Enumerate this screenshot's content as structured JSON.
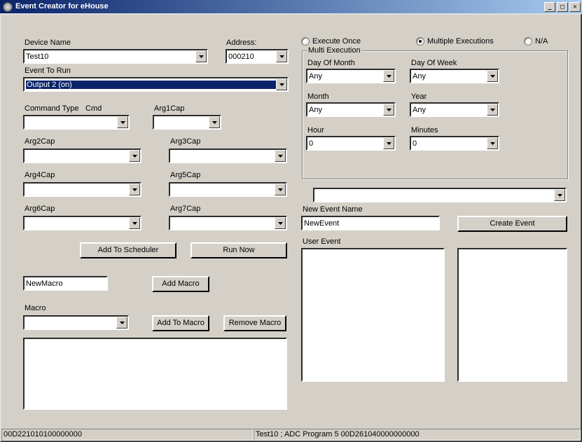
{
  "window": {
    "title": "Event Creator for eHouse"
  },
  "left": {
    "device_name_label": "Device Name",
    "device_name": "Test10",
    "address_label": "Address:",
    "address": "000210",
    "event_to_run_label": "Event To Run",
    "event_to_run": "Output 2 (on)",
    "command_type_label": "Command Type",
    "cmd_label": "Cmd",
    "command_type": "",
    "cmd": "",
    "arg1_label": "Arg1Cap",
    "arg1": "",
    "arg2_label": "Arg2Cap",
    "arg2": "",
    "arg3_label": "Arg3Cap",
    "arg3": "",
    "arg4_label": "Arg4Cap",
    "arg4": "",
    "arg5_label": "Arg5Cap",
    "arg5": "",
    "arg6_label": "Arg6Cap",
    "arg6": "",
    "arg7_label": "Arg7Cap",
    "arg7": "",
    "add_to_scheduler_btn": "Add To Scheduler",
    "run_now_btn": "Run Now",
    "newmacro_value": "NewMacro",
    "add_macro_btn": "Add Macro",
    "macro_label": "Macro",
    "macro": "",
    "add_to_macro_btn": "Add To Macro",
    "remove_macro_btn": "Remove Macro"
  },
  "right": {
    "execute_once": "Execute Once",
    "multiple_executions": "Multiple Executions",
    "na": "N/A",
    "radio_selected": "multiple",
    "group_label": "Multi Execution",
    "day_of_month_label": "Day Of Month",
    "day_of_month": "Any",
    "day_of_week_label": "Day Of Week",
    "day_of_week": "Any",
    "month_label": "Month",
    "month": "Any",
    "year_label": "Year",
    "year": "Any",
    "hour_label": "Hour",
    "hour": "0",
    "minutes_label": "Minutes",
    "minutes": "0",
    "extra_combo": "",
    "new_event_name_label": "New Event Name",
    "new_event_name": "NewEvent",
    "create_event_btn": "Create Event",
    "user_event_label": "User Event"
  },
  "status": {
    "cell1": "00D221010100000000",
    "cell2": "Test10 ; ADC Program 5 00D261040000000000"
  }
}
